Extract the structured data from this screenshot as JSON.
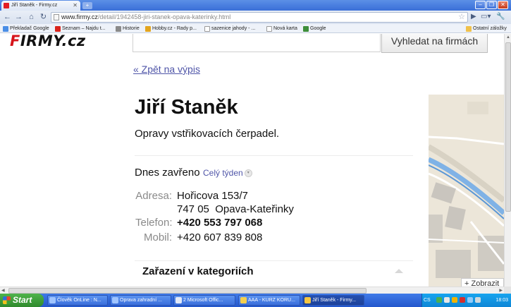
{
  "browser": {
    "tab_title": "Jiří Staněk - Firmy.cz",
    "url_host": "www.firmy.cz",
    "url_path": "/detail/1942458-jiri-stanek-opava-katerinky.html",
    "bookmarks": [
      "Překladač Google",
      "Seznam – Najdu t...",
      "Historie",
      "Hobby.cz - Rady p...",
      "sazenice jahody - ...",
      "Nová karta",
      "Google"
    ],
    "other_bookmarks": "Ostatní záložky"
  },
  "site": {
    "logo_red": "F",
    "logo_rest": "IRMY.cz",
    "search_button": "Vyhledat na firmách"
  },
  "detail": {
    "back_link": "« Zpět na výpis",
    "name": "Jiří Staněk",
    "description": "Opravy vstřikovacích čerpadel.",
    "hours_status": "Dnes zavřeno",
    "week_link": "Celý týden",
    "address_label": "Adresa:",
    "address_line1": "Hořicova 153/7",
    "address_line2": "747 05  Opava-Kateřinky",
    "phone_label": "Telefon:",
    "phone": "+420 553 797 068",
    "mobile_label": "Mobil:",
    "mobile": "+420 607 839 808",
    "categories_heading": "Zařazení v kategoriích"
  },
  "map": {
    "zoom_label": "+ Zobrazit"
  },
  "taskbar": {
    "start": "Start",
    "tasks": [
      "Člověk OnLine : N...",
      "Oprava zahradní ...",
      "2 Microsoft Offic...",
      "AAA - KURZ KORU...",
      "Jiří Staněk - Firmy..."
    ],
    "language": "CS",
    "clock": "18:03"
  }
}
